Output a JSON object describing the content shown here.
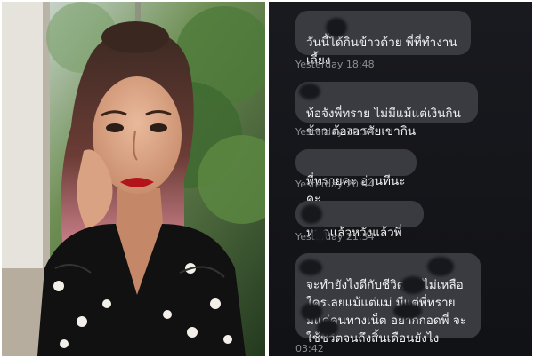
{
  "messages": [
    {
      "text": "วันนี้ได้กินข้าวด้วย พี่ที่ทำงานเลี้ยง",
      "timestamp": "Yesterday 18:48"
    },
    {
      "text": "ท้อจังพี่ทราย ไม่มีแม้แต่เงินกินข้าว ต้องอาศัยเขากิน",
      "timestamp": "Yesterday 18:54"
    },
    {
      "text": "พี่ทรายคะ อ่านทีนะคะ",
      "timestamp": "Yesterday 20:44"
    },
    {
      "text": "หมดแล้วหวังแล้วพี่",
      "timestamp": "Yesterday 21:34"
    },
    {
      "text": "จะทำยังไงดีกับชีวิตคะ ไม่เหลือใครเลยแม้แต่แม่ มีแต่พี่ทราย\nมีแค่คนทางเน็ต อยากกอดพี่ จะใช้ชีวิตจนถึงสิ้นเดือนยังไง",
      "timestamp": "03:42"
    }
  ],
  "colors": {
    "chat_background": "#16171b",
    "bubble": "#3a3b41",
    "bubble_text": "#f1f1f3",
    "timestamp": "#8c8d93",
    "lipstick": "#b3141c"
  }
}
